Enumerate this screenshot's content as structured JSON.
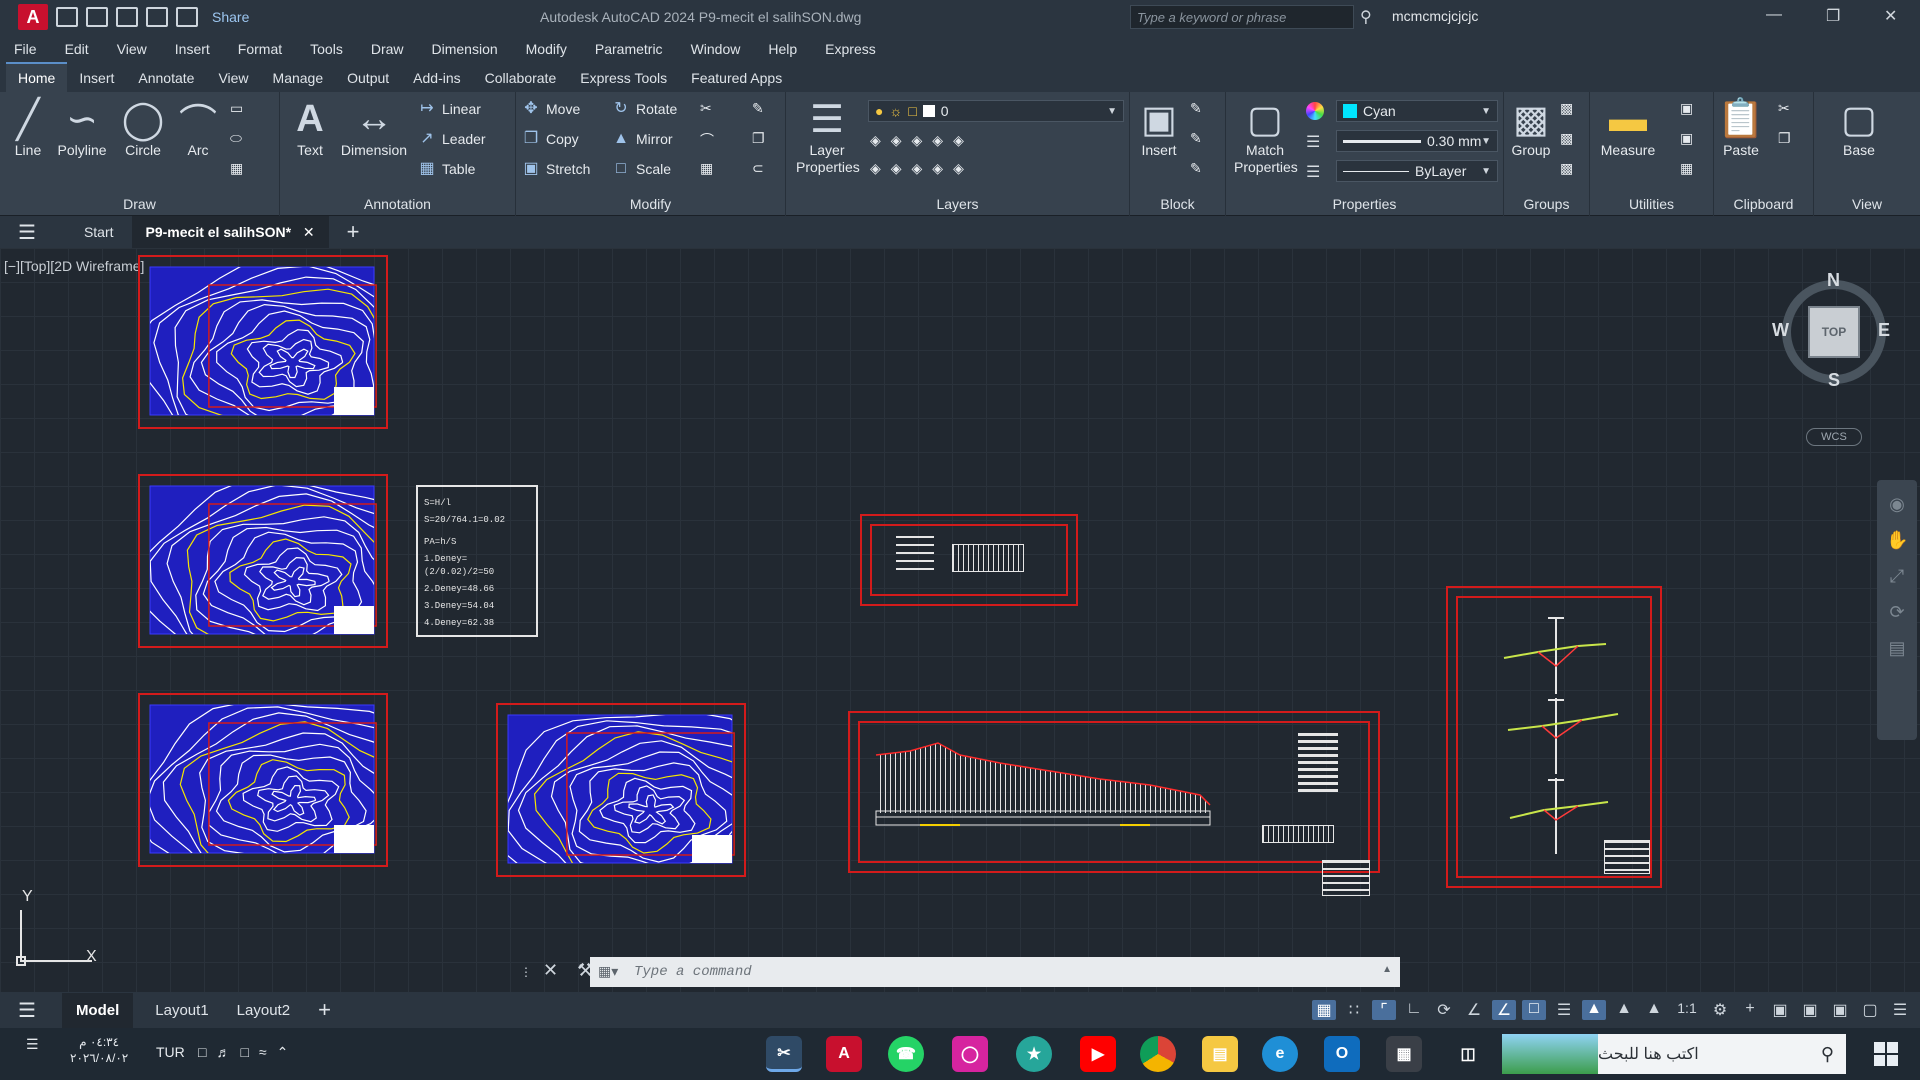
{
  "titlebar": {
    "share_label": "Share",
    "title": "Autodesk AutoCAD 2024   P9-mecit el salihSON.dwg",
    "search_placeholder": "Type a keyword or phrase",
    "username": "mcmcmcjcjcjc"
  },
  "menu": [
    "File",
    "Edit",
    "View",
    "Insert",
    "Format",
    "Tools",
    "Draw",
    "Dimension",
    "Modify",
    "Parametric",
    "Window",
    "Help",
    "Express"
  ],
  "ribbon_tabs": [
    "Home",
    "Insert",
    "Annotate",
    "View",
    "Manage",
    "Output",
    "Add-ins",
    "Collaborate",
    "Express Tools",
    "Featured Apps"
  ],
  "ribbon": {
    "draw": {
      "title": "Draw",
      "line": "Line",
      "polyline": "Polyline",
      "circle": "Circle",
      "arc": "Arc"
    },
    "annotation": {
      "title": "Annotation",
      "text": "Text",
      "dimension": "Dimension",
      "linear": "Linear",
      "leader": "Leader",
      "table": "Table"
    },
    "modify": {
      "title": "Modify",
      "move": "Move",
      "rotate": "Rotate",
      "copy": "Copy",
      "mirror": "Mirror",
      "stretch": "Stretch",
      "scale": "Scale"
    },
    "layers": {
      "title": "Layers",
      "layer_properties": "Layer Properties",
      "current_layer": "0"
    },
    "block": {
      "title": "Block",
      "insert": "Insert"
    },
    "properties": {
      "title": "Properties",
      "match": "Match Properties",
      "color": "Cyan",
      "lineweight": "0.30 mm",
      "linetype": "ByLayer"
    },
    "groups": {
      "title": "Groups",
      "group": "Group"
    },
    "utilities": {
      "title": "Utilities",
      "measure": "Measure"
    },
    "clipboard": {
      "title": "Clipboard",
      "paste": "Paste"
    },
    "view": {
      "title": "View",
      "base": "Base"
    }
  },
  "doctabs": {
    "start": "Start",
    "active": "P9-mecit el salihSON*"
  },
  "canvas": {
    "view_label": "[−][Top][2D Wireframe]",
    "notes": [
      "S=H/l",
      "S=20/764.1=0.02",
      "PA=h/S",
      "1.Deney=(2/0.02)/2=50",
      "2.Deney=48.66",
      "3.Deney=54.04",
      "4.Deney=62.38"
    ]
  },
  "viewcube": {
    "n": "N",
    "s": "S",
    "e": "E",
    "w": "W",
    "face": "TOP",
    "wcs": "WCS"
  },
  "ucs": {
    "x": "X",
    "y": "Y"
  },
  "command": {
    "placeholder": "Type a command"
  },
  "layout_tabs": [
    "Model",
    "Layout1",
    "Layout2"
  ],
  "statusbar": {
    "scale": "1:1"
  },
  "taskbar": {
    "time": "٠٤:٣٤ م",
    "date": "٢٠٢٦/٠٨/٠٢",
    "language": "TUR",
    "search_placeholder": "اكتب هنا للبحث"
  },
  "colors": {
    "accent": "#5b8ec8",
    "sheet_border": "#d31b1b",
    "contour_blue": "#1f1fbf",
    "contour_line": "#ffffff"
  }
}
